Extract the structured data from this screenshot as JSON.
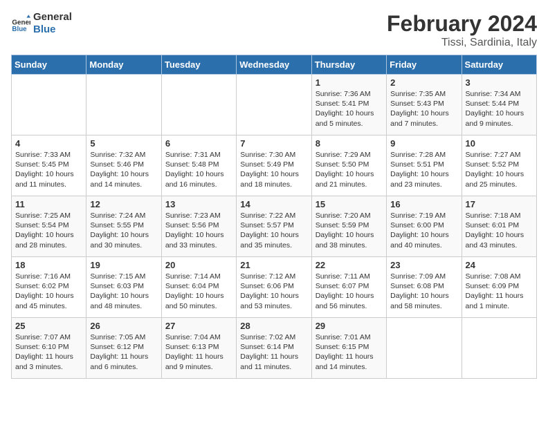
{
  "logo": {
    "line1": "General",
    "line2": "Blue"
  },
  "header": {
    "title": "February 2024",
    "subtitle": "Tissi, Sardinia, Italy"
  },
  "weekdays": [
    "Sunday",
    "Monday",
    "Tuesday",
    "Wednesday",
    "Thursday",
    "Friday",
    "Saturday"
  ],
  "weeks": [
    [
      {
        "day": "",
        "info": ""
      },
      {
        "day": "",
        "info": ""
      },
      {
        "day": "",
        "info": ""
      },
      {
        "day": "",
        "info": ""
      },
      {
        "day": "1",
        "info": "Sunrise: 7:36 AM\nSunset: 5:41 PM\nDaylight: 10 hours\nand 5 minutes."
      },
      {
        "day": "2",
        "info": "Sunrise: 7:35 AM\nSunset: 5:43 PM\nDaylight: 10 hours\nand 7 minutes."
      },
      {
        "day": "3",
        "info": "Sunrise: 7:34 AM\nSunset: 5:44 PM\nDaylight: 10 hours\nand 9 minutes."
      }
    ],
    [
      {
        "day": "4",
        "info": "Sunrise: 7:33 AM\nSunset: 5:45 PM\nDaylight: 10 hours\nand 11 minutes."
      },
      {
        "day": "5",
        "info": "Sunrise: 7:32 AM\nSunset: 5:46 PM\nDaylight: 10 hours\nand 14 minutes."
      },
      {
        "day": "6",
        "info": "Sunrise: 7:31 AM\nSunset: 5:48 PM\nDaylight: 10 hours\nand 16 minutes."
      },
      {
        "day": "7",
        "info": "Sunrise: 7:30 AM\nSunset: 5:49 PM\nDaylight: 10 hours\nand 18 minutes."
      },
      {
        "day": "8",
        "info": "Sunrise: 7:29 AM\nSunset: 5:50 PM\nDaylight: 10 hours\nand 21 minutes."
      },
      {
        "day": "9",
        "info": "Sunrise: 7:28 AM\nSunset: 5:51 PM\nDaylight: 10 hours\nand 23 minutes."
      },
      {
        "day": "10",
        "info": "Sunrise: 7:27 AM\nSunset: 5:52 PM\nDaylight: 10 hours\nand 25 minutes."
      }
    ],
    [
      {
        "day": "11",
        "info": "Sunrise: 7:25 AM\nSunset: 5:54 PM\nDaylight: 10 hours\nand 28 minutes."
      },
      {
        "day": "12",
        "info": "Sunrise: 7:24 AM\nSunset: 5:55 PM\nDaylight: 10 hours\nand 30 minutes."
      },
      {
        "day": "13",
        "info": "Sunrise: 7:23 AM\nSunset: 5:56 PM\nDaylight: 10 hours\nand 33 minutes."
      },
      {
        "day": "14",
        "info": "Sunrise: 7:22 AM\nSunset: 5:57 PM\nDaylight: 10 hours\nand 35 minutes."
      },
      {
        "day": "15",
        "info": "Sunrise: 7:20 AM\nSunset: 5:59 PM\nDaylight: 10 hours\nand 38 minutes."
      },
      {
        "day": "16",
        "info": "Sunrise: 7:19 AM\nSunset: 6:00 PM\nDaylight: 10 hours\nand 40 minutes."
      },
      {
        "day": "17",
        "info": "Sunrise: 7:18 AM\nSunset: 6:01 PM\nDaylight: 10 hours\nand 43 minutes."
      }
    ],
    [
      {
        "day": "18",
        "info": "Sunrise: 7:16 AM\nSunset: 6:02 PM\nDaylight: 10 hours\nand 45 minutes."
      },
      {
        "day": "19",
        "info": "Sunrise: 7:15 AM\nSunset: 6:03 PM\nDaylight: 10 hours\nand 48 minutes."
      },
      {
        "day": "20",
        "info": "Sunrise: 7:14 AM\nSunset: 6:04 PM\nDaylight: 10 hours\nand 50 minutes."
      },
      {
        "day": "21",
        "info": "Sunrise: 7:12 AM\nSunset: 6:06 PM\nDaylight: 10 hours\nand 53 minutes."
      },
      {
        "day": "22",
        "info": "Sunrise: 7:11 AM\nSunset: 6:07 PM\nDaylight: 10 hours\nand 56 minutes."
      },
      {
        "day": "23",
        "info": "Sunrise: 7:09 AM\nSunset: 6:08 PM\nDaylight: 10 hours\nand 58 minutes."
      },
      {
        "day": "24",
        "info": "Sunrise: 7:08 AM\nSunset: 6:09 PM\nDaylight: 11 hours\nand 1 minute."
      }
    ],
    [
      {
        "day": "25",
        "info": "Sunrise: 7:07 AM\nSunset: 6:10 PM\nDaylight: 11 hours\nand 3 minutes."
      },
      {
        "day": "26",
        "info": "Sunrise: 7:05 AM\nSunset: 6:12 PM\nDaylight: 11 hours\nand 6 minutes."
      },
      {
        "day": "27",
        "info": "Sunrise: 7:04 AM\nSunset: 6:13 PM\nDaylight: 11 hours\nand 9 minutes."
      },
      {
        "day": "28",
        "info": "Sunrise: 7:02 AM\nSunset: 6:14 PM\nDaylight: 11 hours\nand 11 minutes."
      },
      {
        "day": "29",
        "info": "Sunrise: 7:01 AM\nSunset: 6:15 PM\nDaylight: 11 hours\nand 14 minutes."
      },
      {
        "day": "",
        "info": ""
      },
      {
        "day": "",
        "info": ""
      }
    ]
  ]
}
